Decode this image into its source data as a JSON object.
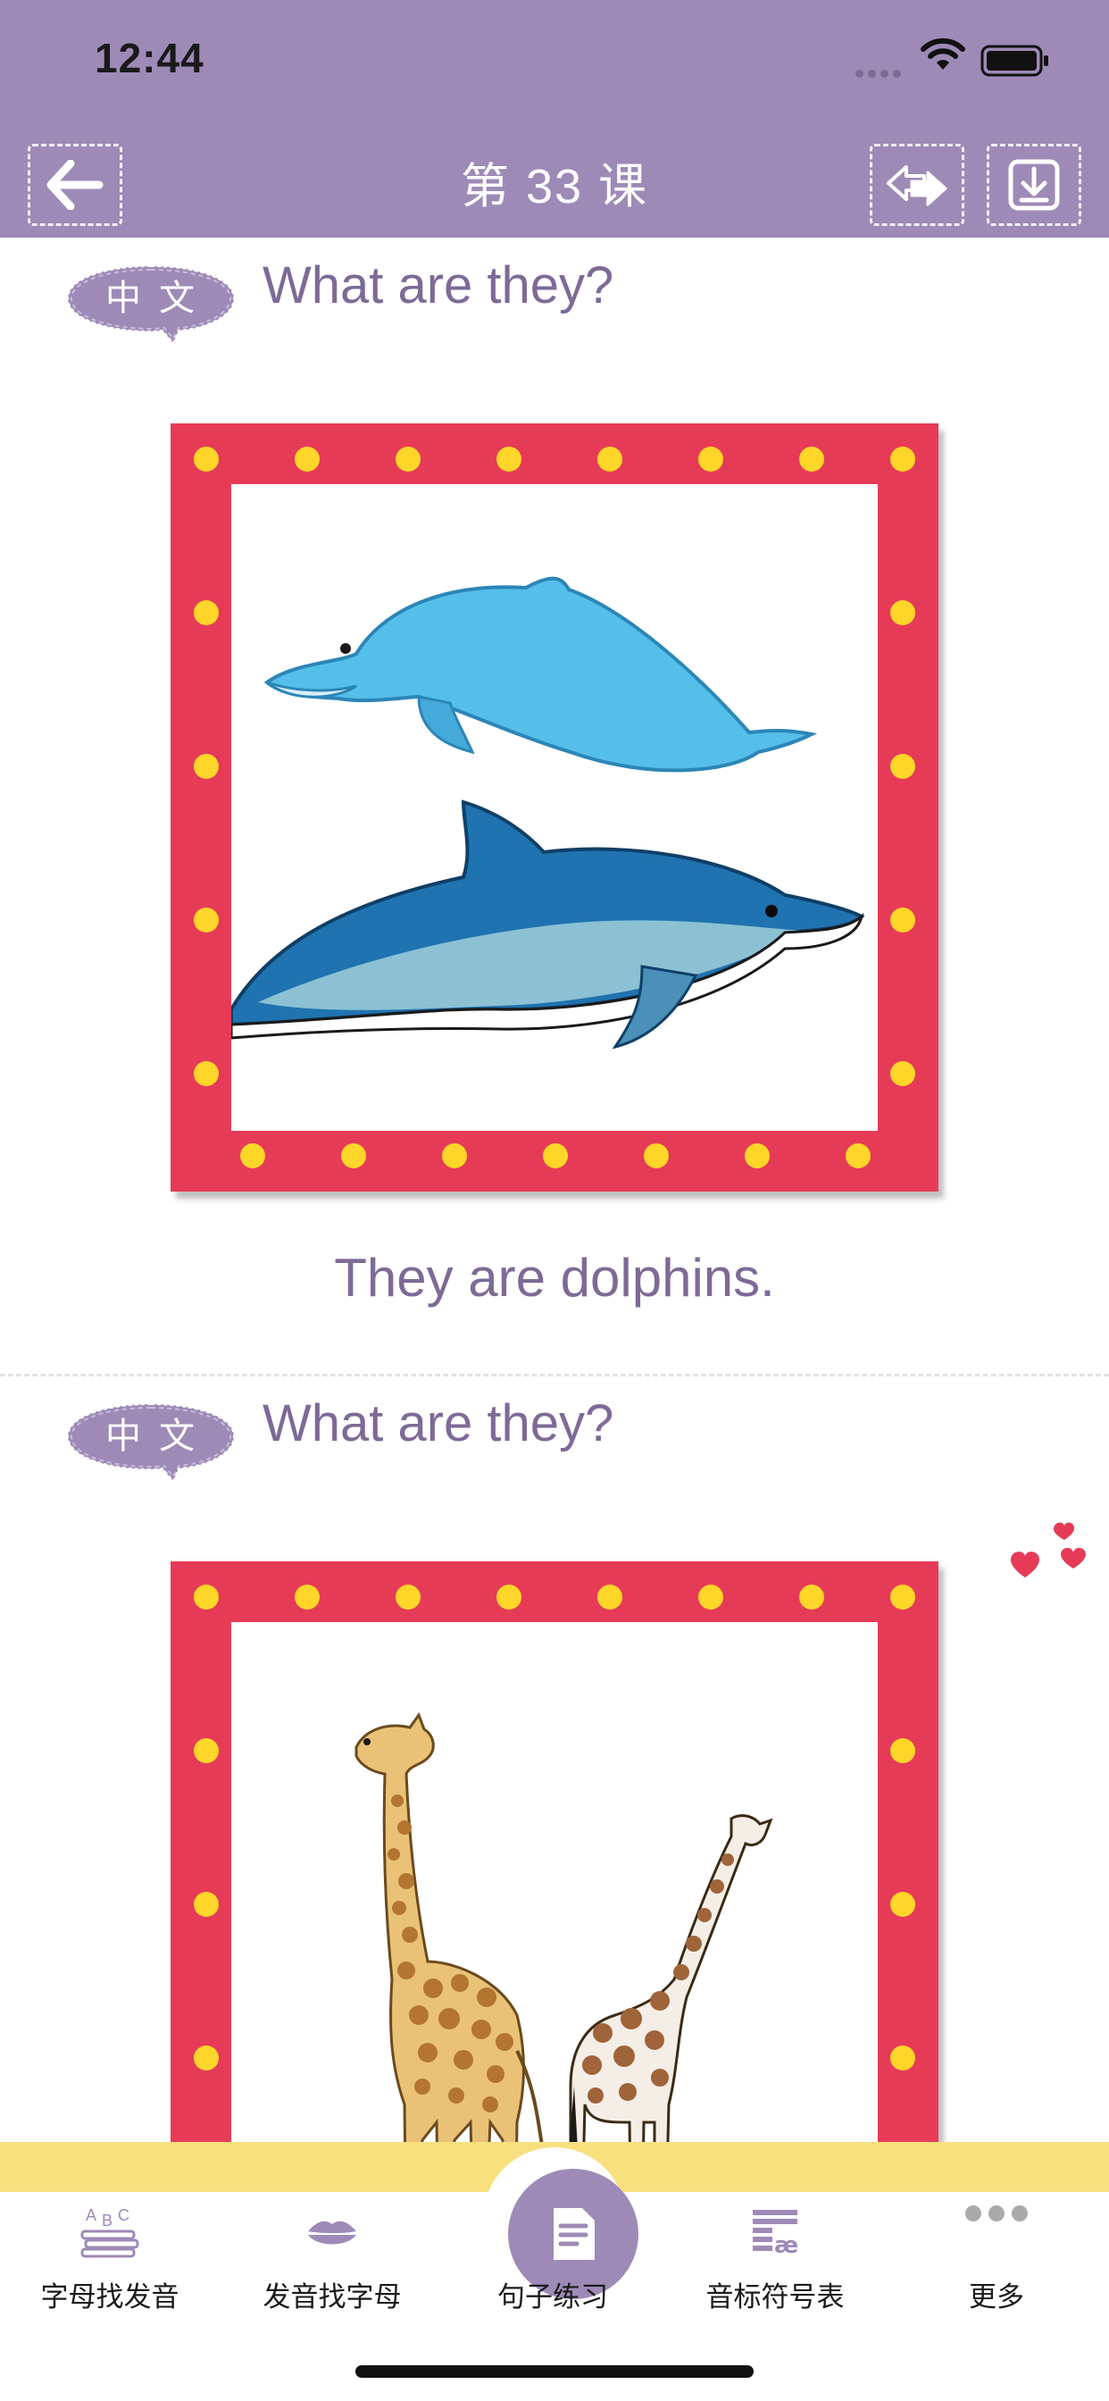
{
  "status_bar": {
    "time": "12:44"
  },
  "header": {
    "title": "第 33 课"
  },
  "lessons": [
    {
      "bubble": "中文",
      "question": "What are they?",
      "answer": "They are dolphins.",
      "image": "dolphins"
    },
    {
      "bubble": "中文",
      "question": "What are they?",
      "answer": "",
      "image": "giraffes"
    }
  ],
  "tabbar": {
    "items": [
      {
        "label": "字母找发音",
        "icon": "abc-books-icon"
      },
      {
        "label": "发音找字母",
        "icon": "lips-icon"
      },
      {
        "label": "句子练习",
        "icon": "document-icon"
      },
      {
        "label": "音标符号表",
        "icon": "phonetic-table-icon"
      },
      {
        "label": "更多",
        "icon": "more-dots-icon"
      }
    ]
  },
  "colors": {
    "header": "#9e8ab7",
    "frame": "#e63b56",
    "frame_dot": "#fdd629",
    "text_purple": "#7d6a97",
    "band": "#f8e07f"
  }
}
